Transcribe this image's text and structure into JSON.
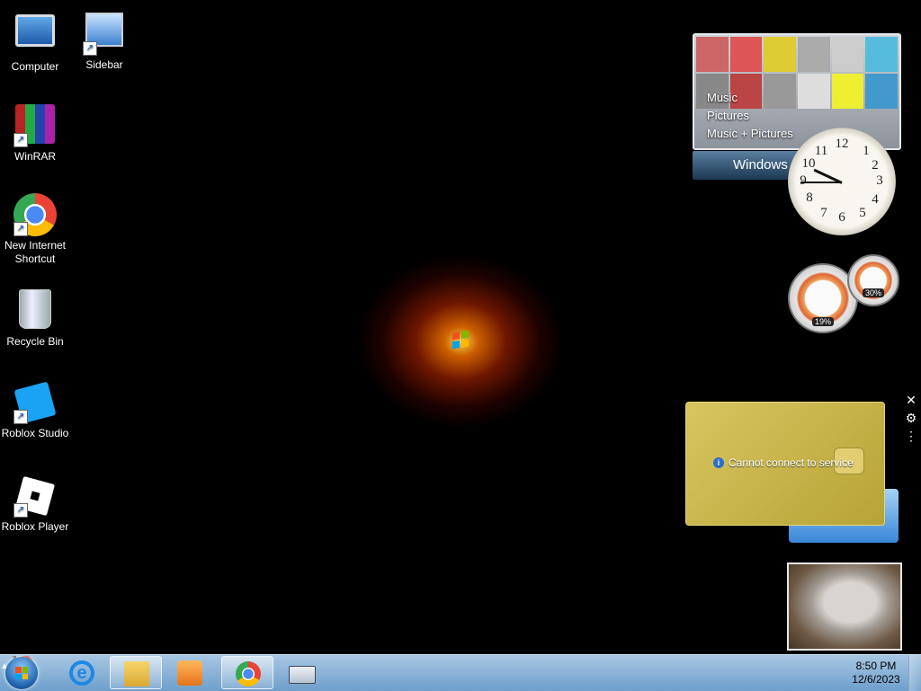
{
  "desktop_icons": [
    {
      "label": "Computer",
      "icon": "computer-icon"
    },
    {
      "label": "Sidebar",
      "icon": "sidebar-icon"
    },
    {
      "label": "WinRAR",
      "icon": "winrar-icon"
    },
    {
      "label": "New Internet Shortcut",
      "icon": "chrome-icon"
    },
    {
      "label": "Recycle Bin",
      "icon": "recycle-bin-icon"
    },
    {
      "label": "Roblox Studio",
      "icon": "roblox-studio-icon"
    },
    {
      "label": "Roblox Player",
      "icon": "roblox-player-icon"
    }
  ],
  "media_gadget": {
    "items": [
      "Music",
      "Pictures",
      "Music + Pictures"
    ],
    "bar_label": "Windows"
  },
  "clock_gadget": {
    "numbers": [
      "12",
      "1",
      "2",
      "3",
      "4",
      "5",
      "6",
      "7",
      "8",
      "9",
      "10",
      "11"
    ]
  },
  "cpu_meter": {
    "cpu_percent_label": "19%",
    "memory_percent_label": "30%",
    "cpu_percent": 19,
    "memory_percent": 30
  },
  "currency_gadget": {
    "message": "Cannot connect to service"
  },
  "gadget_controls": {
    "close": "✕",
    "options": "⚙",
    "drag": "⋮"
  },
  "taskbar": {
    "programs": [
      {
        "name": "internet-explorer",
        "active": false
      },
      {
        "name": "windows-explorer",
        "active": true
      },
      {
        "name": "windows-media-player",
        "active": false
      },
      {
        "name": "google-chrome",
        "active": true
      },
      {
        "name": "on-screen-keyboard",
        "active": false
      }
    ],
    "tray": {
      "show_hidden": "▲",
      "time": "8:50 PM",
      "date": "12/6/2023"
    }
  },
  "colors": {
    "taskbar_top": "#a7c7e3",
    "taskbar_bottom": "#6e9fcb",
    "desktop_bg": "#000000"
  }
}
